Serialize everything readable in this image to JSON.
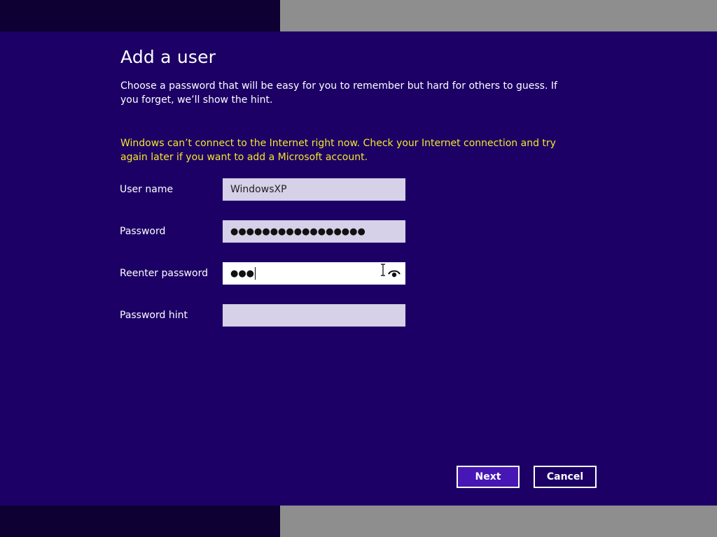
{
  "page": {
    "title": "Add a user",
    "description": "Choose a password that will be easy for you to remember but hard for others to guess. If you forget, we’ll show the hint.",
    "warning": "Windows can’t connect to the Internet right now. Check your Internet connection and try again later if you want to add a Microsoft account."
  },
  "form": {
    "username": {
      "label": "User name",
      "value": "WindowsXP"
    },
    "password": {
      "label": "Password",
      "masked_value": "●●●●●●●●●●●●●●●●●"
    },
    "reenter_password": {
      "label": "Reenter password",
      "masked_value": "●●●"
    },
    "password_hint": {
      "label": "Password hint",
      "value": ""
    }
  },
  "buttons": {
    "next": "Next",
    "cancel": "Cancel"
  },
  "colors": {
    "background": "#1c0066",
    "warning_text": "#f5e62b",
    "field_background": "#d6d0e8",
    "primary_button": "#4617b4"
  },
  "icons": {
    "reveal": "eye-icon",
    "cursor": "ibeam-cursor-icon"
  }
}
